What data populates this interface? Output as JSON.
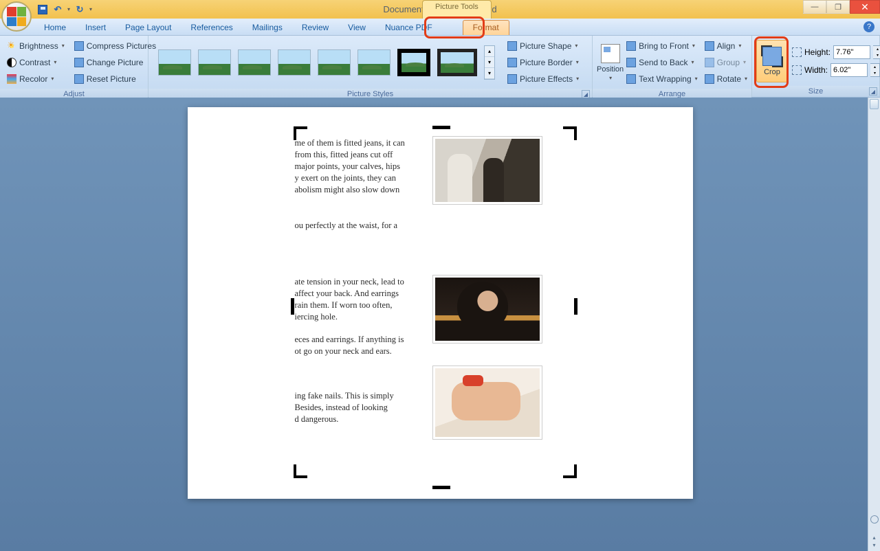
{
  "window": {
    "title": "Document1 - Microsoft Word",
    "context_tab": "Picture Tools"
  },
  "tabs": [
    "Home",
    "Insert",
    "Page Layout",
    "References",
    "Mailings",
    "Review",
    "View",
    "Nuance PDF",
    "Format"
  ],
  "active_tab": "Format",
  "adjust": {
    "brightness": "Brightness",
    "contrast": "Contrast",
    "recolor": "Recolor",
    "compress": "Compress Pictures",
    "change": "Change Picture",
    "reset": "Reset Picture",
    "label": "Adjust"
  },
  "styles": {
    "shape": "Picture Shape",
    "border": "Picture Border",
    "effects": "Picture Effects",
    "label": "Picture Styles"
  },
  "arrange": {
    "position": "Position",
    "bring_front": "Bring to Front",
    "send_back": "Send to Back",
    "wrap": "Text Wrapping",
    "align": "Align",
    "group": "Group",
    "rotate": "Rotate",
    "label": "Arrange"
  },
  "crop": {
    "label": "Crop"
  },
  "size": {
    "height_lbl": "Height:",
    "width_lbl": "Width:",
    "height": "7.76\"",
    "width": "6.02\"",
    "label": "Size"
  },
  "document": {
    "p1": "me of them is fitted jeans, it can\nfrom this, fitted jeans cut off\nmajor points,   your calves, hips\ny exert on the joints, they can\nabolism might also slow down",
    "p1b": "ou perfectly at the waist, for a",
    "p2": "ate tension in your neck, lead to\naffect your back. And earrings\nrain them. If worn too often,\niercing hole.",
    "p2b": "eces and earrings. If anything is\not go on your neck and ears.",
    "p3": "ing fake nails. This is simply\nBesides, instead of looking\nd dangerous."
  }
}
